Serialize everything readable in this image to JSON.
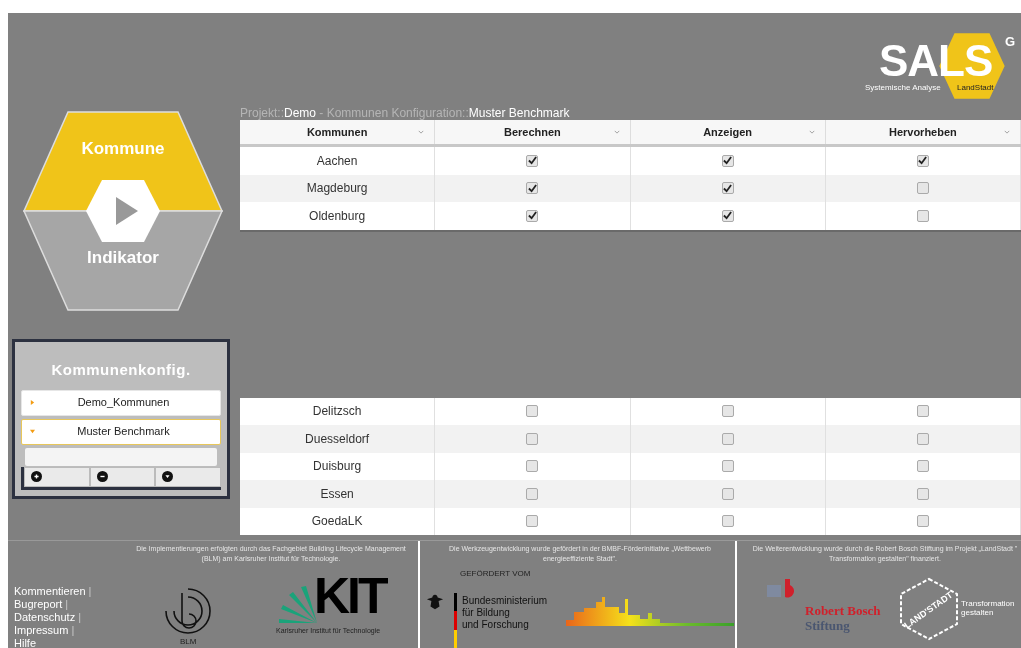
{
  "logo": {
    "text": "SALS",
    "superscript": "G",
    "subtitle_left": "Systemische Analyse",
    "subtitle_right": "LandStadt"
  },
  "breadcrumb": [
    {
      "text": "Projekt::",
      "highlight": false
    },
    {
      "text": "Demo",
      "highlight": true
    },
    {
      "text": " - Kommunen Konfiguration::",
      "highlight": false
    },
    {
      "text": "Muster Benchmark",
      "highlight": true
    }
  ],
  "navigator": {
    "sections": [
      {
        "label": "Kommune",
        "selected": true
      },
      {
        "label": "Indikator",
        "selected": false
      }
    ]
  },
  "config_panel": {
    "title": "Kommunenkonfig.",
    "items": [
      {
        "label": "Demo_Kommunen",
        "expanded": false,
        "selected": false
      },
      {
        "label": "Muster Benchmark",
        "expanded": true,
        "selected": true
      }
    ],
    "tools": [
      {
        "kind": "add"
      },
      {
        "kind": "remove"
      },
      {
        "kind": "down"
      }
    ]
  },
  "table": {
    "columns": [
      "Kommunen",
      "Berechnen",
      "Anzeigen",
      "Hervorheben"
    ],
    "rows": [
      {
        "name": "Aachen",
        "checks": [
          true,
          true,
          true
        ]
      },
      {
        "name": "Magdeburg",
        "checks": [
          true,
          true,
          false
        ]
      },
      {
        "name": "Oldenburg",
        "checks": [
          true,
          true,
          false
        ]
      }
    ]
  },
  "table_lower": {
    "rows": [
      {
        "name": "Delitzsch",
        "checks": [
          false,
          false,
          false
        ]
      },
      {
        "name": "Duesseldorf",
        "checks": [
          false,
          false,
          false
        ]
      },
      {
        "name": "Duisburg",
        "checks": [
          false,
          false,
          false
        ]
      },
      {
        "name": "Essen",
        "checks": [
          false,
          false,
          false
        ]
      },
      {
        "name": "GoedaLK",
        "checks": [
          false,
          false,
          false
        ]
      }
    ]
  },
  "footer": {
    "links": [
      {
        "label": "Kommentieren",
        "separator": "|"
      },
      {
        "label": "Bugreport",
        "separator": "|"
      },
      {
        "label": "Datenschutz",
        "separator": "|"
      },
      {
        "label": "Impressum",
        "separator": "|"
      },
      {
        "label": "Hilfe"
      }
    ],
    "blm_note": "Die Implementierungen erfolgten durch das Fachgebiet Building Lifecycle Management (BLM) am Karlsruher Institut für Technologie.",
    "blm_label": "BLM",
    "kit_letters": "KIT",
    "kit_label": "Karlsruher Institut für Technologie",
    "bmbf_note": "Die Werkzeugentwicklung wurde gefördert in der BMBF-Förderinitiative „Wettbewerb energieeffiziente Stadt\".",
    "bmbf_funded": "GEFÖRDERT VOM",
    "bmbf_lines": [
      "Bundesministerium",
      "für Bildung",
      "und Forschung"
    ],
    "bosch_note": "Die Weiterentwicklung wurde durch die Robert Bosch Stiftung im Projekt „LandStadt \" Transformation gestalten\" finanziert.",
    "bosch_name": "Robert Bosch",
    "bosch_sub": "Stiftung",
    "landstadt": "LAND'STADT",
    "landstadt_sub": "Transformation gestalten"
  }
}
